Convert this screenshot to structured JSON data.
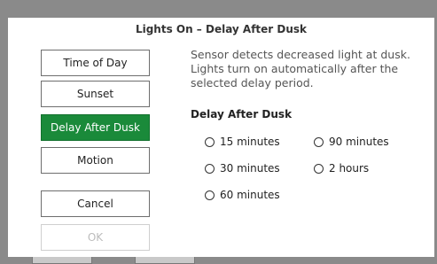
{
  "dialog": {
    "title": "Lights On – Delay After Dusk",
    "description": "Sensor detects decreased light at dusk. Lights turn on automatically after the selected delay period.",
    "section_label": "Delay After Dusk"
  },
  "modes": {
    "time_of_day": "Time of Day",
    "sunset": "Sunset",
    "delay_after_dusk": "Delay After Dusk",
    "motion": "Motion",
    "selected": "Delay After Dusk"
  },
  "actions": {
    "cancel": "Cancel",
    "ok": "OK"
  },
  "delay_options": {
    "opt_15": "15 minutes",
    "opt_30": "30 minutes",
    "opt_60": "60 minutes",
    "opt_90": "90 minutes",
    "opt_2h": "2 hours"
  },
  "colors": {
    "accent": "#1a8a3a",
    "overlay": "#8a8a8a"
  }
}
